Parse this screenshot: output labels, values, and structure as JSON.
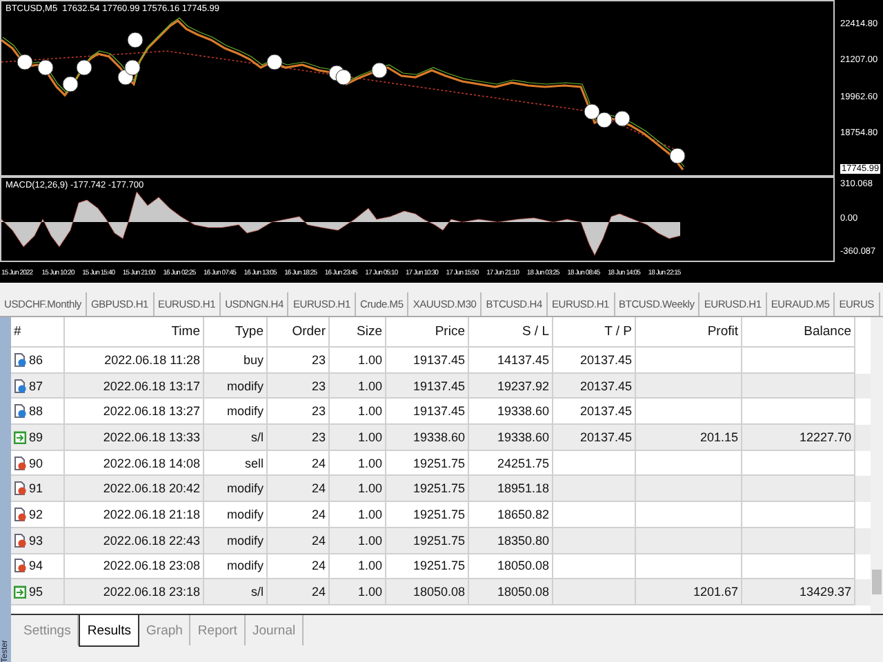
{
  "chart": {
    "header": "BTCUSD,M5  17632.54 17760.99 17576.16 17745.99",
    "price_axis": [
      "22414.80",
      "21207.00",
      "19962.60",
      "18754.80"
    ],
    "current_price": "17745.99",
    "indicator": {
      "label": "MACD(12,26,9) -177.742 -177.700",
      "axis": [
        "310.068",
        "0.00",
        "-360.087"
      ]
    },
    "time_axis": [
      "15 Jun 2022",
      "15 Jun 10:20",
      "15 Jun 15:40",
      "15 Jun 21:00",
      "16 Jun 02:25",
      "16 Jun 07:45",
      "16 Jun 13:05",
      "16 Jun 18:25",
      "16 Jun 23:45",
      "17 Jun 05:10",
      "17 Jun 10:30",
      "17 Jun 15:50",
      "17 Jun 21:10",
      "18 Jun 03:25",
      "18 Jun 08:45",
      "18 Jun 14:05",
      "18 Jun 22:15"
    ]
  },
  "chart_tabs": [
    {
      "label": "USDCHF.Monthly",
      "selected": false
    },
    {
      "label": "GBPUSD.H1",
      "selected": false
    },
    {
      "label": "EURUSD.H1",
      "selected": false
    },
    {
      "label": "USDNGN.H4",
      "selected": false
    },
    {
      "label": "EURUSD.H1",
      "selected": false
    },
    {
      "label": "Crude.M5",
      "selected": false
    },
    {
      "label": "XAUUSD.M30",
      "selected": false
    },
    {
      "label": "BTCUSD.H4",
      "selected": false
    },
    {
      "label": "EURUSD.H1",
      "selected": false
    },
    {
      "label": "BTCUSD.Weekly",
      "selected": false
    },
    {
      "label": "EURUSD.H1",
      "selected": false
    },
    {
      "label": "EURAUD.M5",
      "selected": false
    },
    {
      "label": "EURUS",
      "selected": false
    }
  ],
  "table": {
    "columns": [
      "#",
      "Time",
      "Type",
      "Order",
      "Size",
      "Price",
      "S / L",
      "T / P",
      "Profit",
      "Balance"
    ],
    "rows": [
      {
        "kind": "order",
        "color": "#2a7fd4",
        "cells": [
          "86",
          "2022.06.18 11:28",
          "buy",
          "23",
          "1.00",
          "19137.45",
          "14137.45",
          "20137.45",
          "",
          ""
        ]
      },
      {
        "kind": "order",
        "color": "#2a7fd4",
        "cells": [
          "87",
          "2022.06.18 13:17",
          "modify",
          "23",
          "1.00",
          "19137.45",
          "19237.92",
          "20137.45",
          "",
          ""
        ]
      },
      {
        "kind": "order",
        "color": "#2a7fd4",
        "cells": [
          "88",
          "2022.06.18 13:27",
          "modify",
          "23",
          "1.00",
          "19137.45",
          "19338.60",
          "20137.45",
          "",
          ""
        ]
      },
      {
        "kind": "close",
        "color": "#2e9a2e",
        "cells": [
          "89",
          "2022.06.18 13:33",
          "s/l",
          "23",
          "1.00",
          "19338.60",
          "19338.60",
          "20137.45",
          "201.15",
          "12227.70"
        ]
      },
      {
        "kind": "order",
        "color": "#d84a2a",
        "cells": [
          "90",
          "2022.06.18 14:08",
          "sell",
          "24",
          "1.00",
          "19251.75",
          "24251.75",
          "",
          "",
          ""
        ]
      },
      {
        "kind": "order",
        "color": "#d84a2a",
        "cells": [
          "91",
          "2022.06.18 20:42",
          "modify",
          "24",
          "1.00",
          "19251.75",
          "18951.18",
          "",
          "",
          ""
        ]
      },
      {
        "kind": "order",
        "color": "#d84a2a",
        "cells": [
          "92",
          "2022.06.18 21:18",
          "modify",
          "24",
          "1.00",
          "19251.75",
          "18650.82",
          "",
          "",
          ""
        ]
      },
      {
        "kind": "order",
        "color": "#d84a2a",
        "cells": [
          "93",
          "2022.06.18 22:43",
          "modify",
          "24",
          "1.00",
          "19251.75",
          "18350.80",
          "",
          "",
          ""
        ]
      },
      {
        "kind": "order",
        "color": "#d84a2a",
        "cells": [
          "94",
          "2022.06.18 23:08",
          "modify",
          "24",
          "1.00",
          "19251.75",
          "18050.08",
          "",
          "",
          ""
        ]
      },
      {
        "kind": "close",
        "color": "#2e9a2e",
        "cells": [
          "95",
          "2022.06.18 23:18",
          "s/l",
          "24",
          "1.00",
          "18050.08",
          "18050.08",
          "",
          "1201.67",
          "13429.37"
        ]
      }
    ]
  },
  "panel_label": "Tester",
  "bottom_tabs": [
    {
      "label": "Settings",
      "selected": false
    },
    {
      "label": "Results",
      "selected": true
    },
    {
      "label": "Graph",
      "selected": false
    },
    {
      "label": "Report",
      "selected": false
    },
    {
      "label": "Journal",
      "selected": false
    }
  ]
}
